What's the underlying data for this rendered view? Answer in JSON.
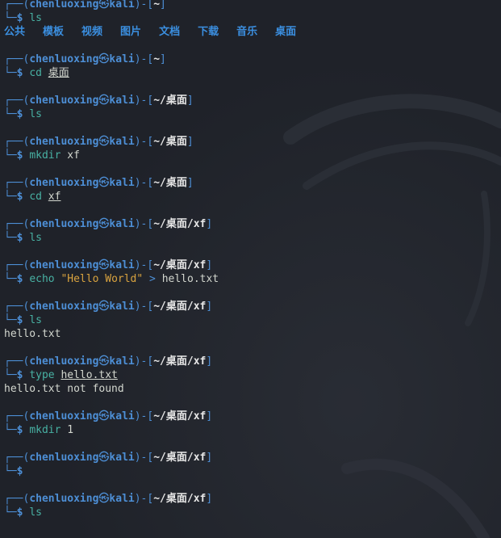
{
  "prompt": {
    "user": "chenluoxing",
    "at_symbol": "㉿",
    "host": "kali",
    "top_left": "┌──(",
    "sep": ")-[",
    "close": "]",
    "bottom": "└─",
    "dollar": "$"
  },
  "paths": {
    "home": "~",
    "desktop": "~/桌面",
    "xf": "~/桌面/xf"
  },
  "ls_home_output": [
    "公共",
    "模板",
    "视频",
    "图片",
    "文档",
    "下载",
    "音乐",
    "桌面"
  ],
  "commands": {
    "c1": "ls",
    "c2_cmd": "cd",
    "c2_arg": "桌面",
    "c3": "ls",
    "c4_cmd": "mkdir",
    "c4_arg": "xf",
    "c5_cmd": "cd",
    "c5_arg": "xf",
    "c6": "ls",
    "c7_cmd": "echo",
    "c7_str": "\"Hello World\"",
    "c7_op": ">",
    "c7_arg": "hello.txt",
    "c8": "ls",
    "c9_cmd": "type",
    "c9_arg": "hello.txt",
    "c10_cmd": "mkdir",
    "c10_arg": "1",
    "c12": "ls"
  },
  "outputs": {
    "ls_xf": "hello.txt",
    "type_result": "hello.txt not found"
  },
  "colors": {
    "background": "#1f2229",
    "prompt_blue": "#4d8fd6",
    "command_teal": "#48b1a3",
    "string_orange": "#d9a33f",
    "text": "#d3d7cf"
  }
}
